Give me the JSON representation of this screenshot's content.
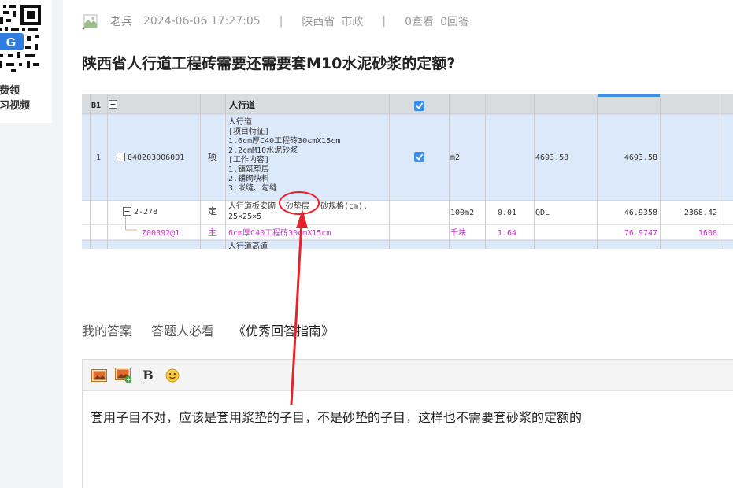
{
  "promo": {
    "line1": "免费领",
    "line2": "学习视频"
  },
  "meta": {
    "author": "老兵",
    "timestamp": "2024-06-06 17:27:05",
    "separator": "|",
    "province": "陕西省",
    "category": "市政",
    "views": "0查看",
    "answers": "0回答"
  },
  "question": {
    "title": "陕西省人行道工程砖需要还需要套M10水泥砂浆的定额?"
  },
  "table": {
    "header": {
      "id": "B1",
      "name": "人行道"
    },
    "row1": {
      "index": "1",
      "code": "040203006001",
      "type": "项",
      "desc": [
        "人行道",
        "[项目特征]",
        "1.6cm厚C40工程砖30cmX15cm",
        "2.2cmM10水泥砂浆",
        "[工作内容]",
        "1.铺筑垫层",
        "2.铺砌块料",
        "3.嵌缝、勾缝"
      ],
      "unit": "m2",
      "qty": "4693.58",
      "total": "4693.58"
    },
    "row2": {
      "code": "2-278",
      "type": "定",
      "desc_a": "人行道板安砌",
      "desc_b": "砂垫层",
      "desc_c": "砂规格(cm),",
      "desc_d": "25×25×5",
      "unit": "100m2",
      "qty": "0.01",
      "expr": "QDL",
      "price": "46.9358",
      "total": "2368.42"
    },
    "row3": {
      "code": "Z00392@1",
      "type": "主",
      "desc": "6cm厚C40工程砖30cmX15cm",
      "unit": "千块",
      "qty": "1.64",
      "price": "76.9747",
      "total": "1608"
    },
    "row4": {
      "desc": "人行道高道"
    }
  },
  "answer_tabs": {
    "my_answer": "我的答案",
    "must_read": "答题人必看",
    "guide": "《优秀回答指南》"
  },
  "editor": {
    "content": "套用子目不对，应该是套用浆垫的子目，不是砂垫的子目，这样也不需要套砂浆的定额的"
  },
  "colors": {
    "row_highlight": "#dce9fb",
    "pink_text": "#cc33cc",
    "annotation_red": "#e8222a",
    "checkbox_blue": "#3d8ee6"
  }
}
